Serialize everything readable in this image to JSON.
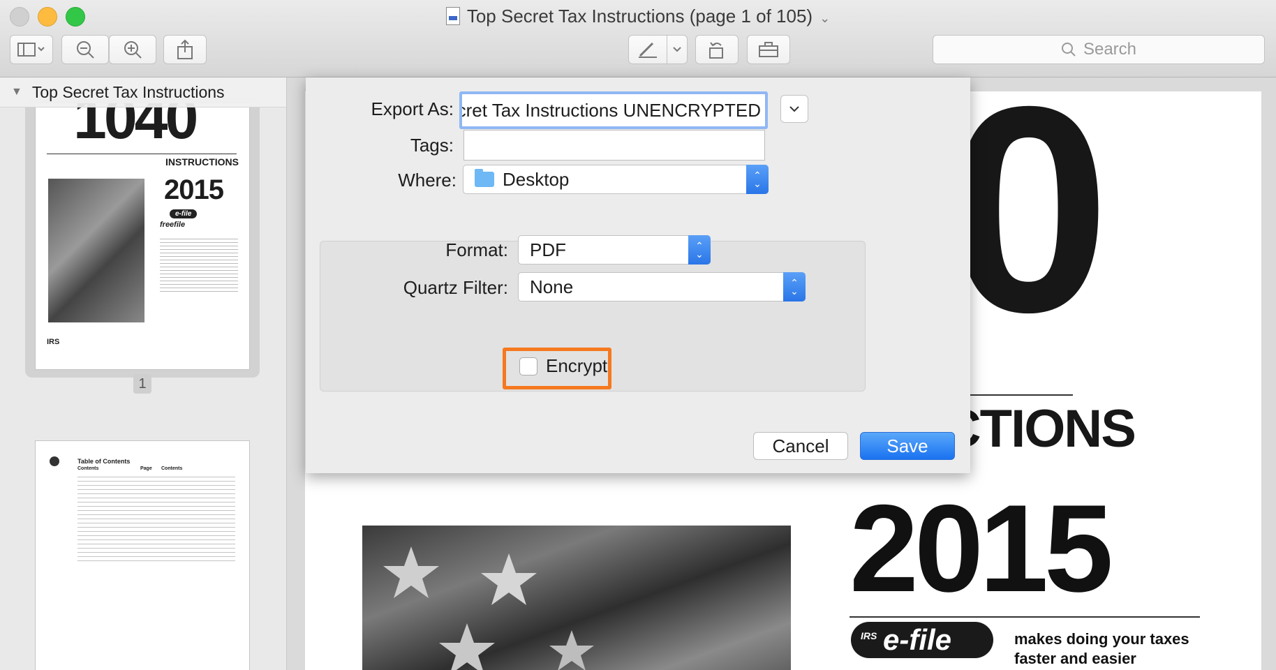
{
  "window": {
    "title": "Top Secret Tax Instructions (page 1 of 105)"
  },
  "toolbar": {
    "search_placeholder": "Search"
  },
  "sidebar": {
    "document_name": "Top Secret Tax Instructions",
    "pages": [
      {
        "number": "1",
        "big_text": "1040",
        "sub_text": "INSTRUCTIONS",
        "year": "2015",
        "efile": "e-file",
        "freefile": "freefile",
        "notes": [
          "2015 TAX CHANGES",
          "FUTURE DEVELOPMENTS"
        ],
        "seal": "IRS"
      },
      {
        "heading": "Table of Contents",
        "col_left": "Contents",
        "col_page": "Page",
        "col_right": "Contents"
      }
    ]
  },
  "document": {
    "big_numeral": "0",
    "instructions_text": "RUCTIONS",
    "year": "2015",
    "efile_logo": "e-file",
    "efile_prefix": "IRS",
    "tagline": "makes doing your taxes",
    "tagline_2": "faster and easier"
  },
  "export_sheet": {
    "export_as_label": "Export As:",
    "export_as_value": "Secret Tax Instructions UNENCRYPTED",
    "tags_label": "Tags:",
    "tags_value": "",
    "where_label": "Where:",
    "where_value": "Desktop",
    "format_label": "Format:",
    "format_value": "PDF",
    "quartz_label": "Quartz Filter:",
    "quartz_value": "None",
    "encrypt_label": "Encrypt",
    "encrypt_checked": false,
    "cancel_label": "Cancel",
    "save_label": "Save"
  },
  "colors": {
    "accent": "#1a72f0",
    "highlight": "#f5791f"
  }
}
